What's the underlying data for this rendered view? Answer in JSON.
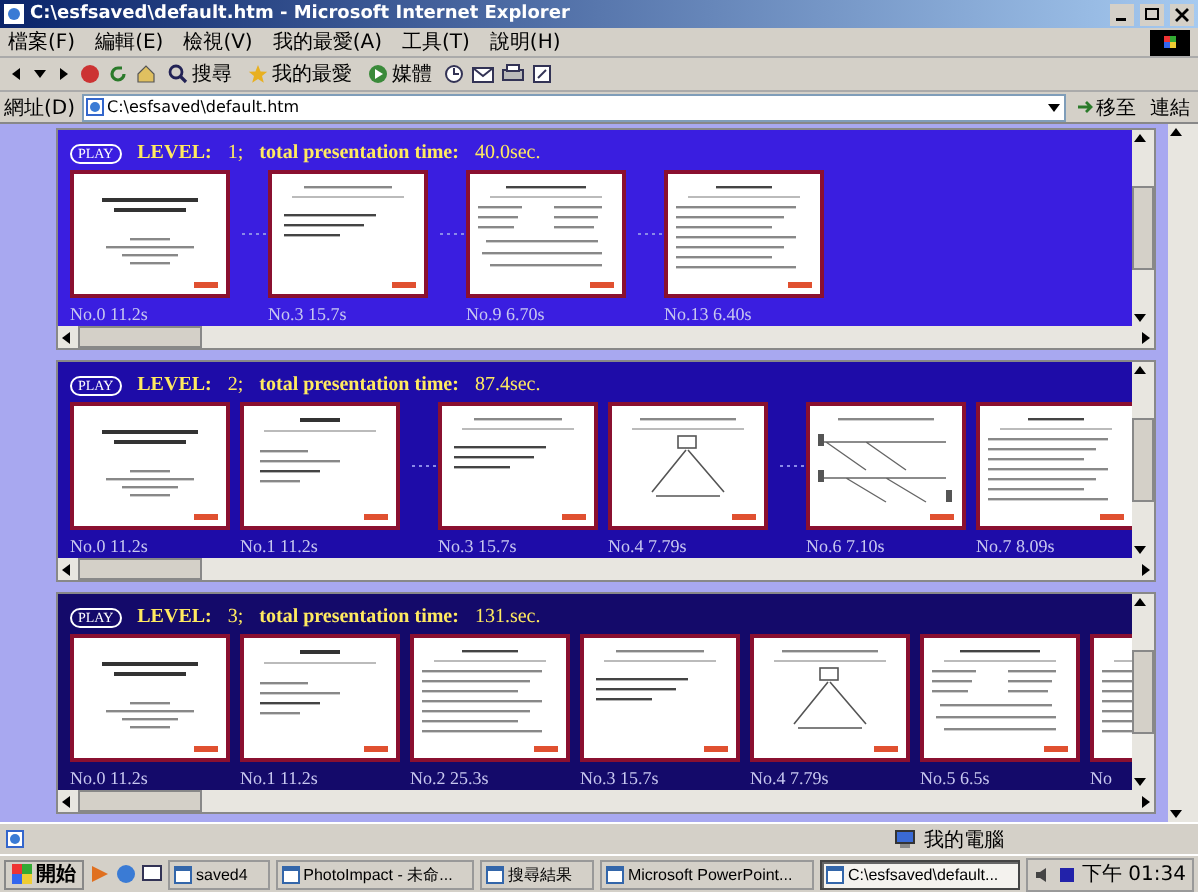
{
  "window": {
    "title": "C:\\esfsaved\\default.htm - Microsoft Internet Explorer"
  },
  "menu": [
    "檔案(F)",
    "編輯(E)",
    "檢視(V)",
    "我的最愛(A)",
    "工具(T)",
    "說明(H)"
  ],
  "toolbar": {
    "buttons": [
      {
        "label": "搜尋",
        "kind": "search"
      },
      {
        "label": "我的最愛",
        "kind": "favorites"
      },
      {
        "label": "媒體",
        "kind": "media"
      }
    ]
  },
  "address_bar": {
    "label": "網址(D)",
    "value": "C:\\esfsaved\\default.htm",
    "go": "移至",
    "links": "連結"
  },
  "levels": [
    {
      "play": "PLAY",
      "level_label": "LEVEL:",
      "level": "1;",
      "time_label": "total presentation time:",
      "time": "40.0sec.",
      "color": "#3a1ee0",
      "slides": [
        {
          "label": "No.0 11.2s",
          "kind": "title",
          "skipped_before": false
        },
        {
          "label": "No.3 15.7s",
          "kind": "bullets",
          "skipped_before": true
        },
        {
          "label": "No.9 6.70s",
          "kind": "table",
          "skipped_before": true
        },
        {
          "label": "No.13 6.40s",
          "kind": "text",
          "skipped_before": true
        }
      ]
    },
    {
      "play": "PLAY",
      "level_label": "LEVEL:",
      "level": "2;",
      "time_label": "total presentation time:",
      "time": "87.4sec.",
      "color": "#1e0ca8",
      "slides": [
        {
          "label": "No.0 11.2s",
          "kind": "title",
          "skipped_before": false
        },
        {
          "label": "No.1 11.2s",
          "kind": "outline",
          "skipped_before": false
        },
        {
          "label": "No.3 15.7s",
          "kind": "bullets",
          "skipped_before": true
        },
        {
          "label": "No.4 7.79s",
          "kind": "diagram",
          "skipped_before": false
        },
        {
          "label": "No.6 7.10s",
          "kind": "flow",
          "skipped_before": true
        },
        {
          "label": "No.7 8.09s",
          "kind": "text",
          "skipped_before": false
        }
      ]
    },
    {
      "play": "PLAY",
      "level_label": "LEVEL:",
      "level": "3;",
      "time_label": "total presentation time:",
      "time": "131.sec.",
      "color": "#140a6a",
      "slides": [
        {
          "label": "No.0 11.2s",
          "kind": "title",
          "skipped_before": false
        },
        {
          "label": "No.1 11.2s",
          "kind": "outline",
          "skipped_before": false
        },
        {
          "label": "No.2 25.3s",
          "kind": "text",
          "skipped_before": false
        },
        {
          "label": "No.3 15.7s",
          "kind": "bullets",
          "skipped_before": false
        },
        {
          "label": "No.4 7.79s",
          "kind": "diagram",
          "skipped_before": false
        },
        {
          "label": "No.5 6.5s",
          "kind": "table",
          "skipped_before": false
        },
        {
          "label": "No",
          "kind": "text",
          "skipped_before": false
        }
      ]
    }
  ],
  "status_bar": {
    "zone": "我的電腦"
  },
  "taskbar": {
    "start": "開始",
    "tasks": [
      {
        "label": "saved4",
        "selected": false
      },
      {
        "label": "PhotoImpact - 未命...",
        "selected": false
      },
      {
        "label": "搜尋結果",
        "selected": false
      },
      {
        "label": "Microsoft PowerPoint...",
        "selected": false
      },
      {
        "label": "C:\\esfsaved\\default...",
        "selected": true
      }
    ],
    "clock": "下午 01:34"
  }
}
